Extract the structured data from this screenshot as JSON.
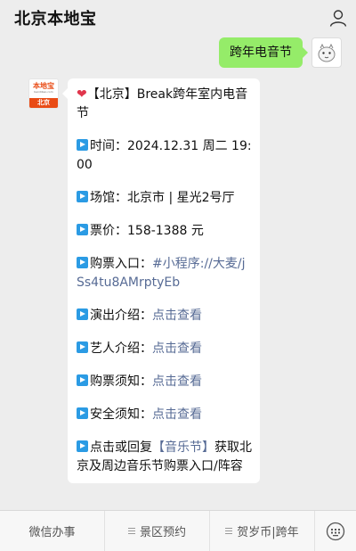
{
  "header": {
    "title": "北京本地宝",
    "profile_icon": "person-icon"
  },
  "outgoing": {
    "text": "跨年电音节"
  },
  "avatar_logo": {
    "main": "本地宝",
    "sub": "bendibao.com",
    "city": "北京"
  },
  "message": {
    "title": "【北京】Break跨年室内电音节",
    "time_label": "时间：",
    "time_value": "2024.12.31 周二 19:00",
    "venue_label": "场馆：",
    "venue_value": "北京市 | 星光2号厅",
    "price_label": "票价：",
    "price_value": "158-1388 元",
    "ticket_label": "购票入口：",
    "ticket_link": "#小程序://大麦/jSs4tu8AMrptyEb",
    "show_label": "演出介绍：",
    "show_link": "点击查看",
    "artist_label": "艺人介绍：",
    "artist_link": "点击查看",
    "notice_label": "购票须知：",
    "notice_link": "点击查看",
    "safety_label": "安全须知：",
    "safety_link": "点击查看",
    "reply_prefix": "点击或回复",
    "reply_keyword": "【音乐节】",
    "reply_suffix": "获取北京及周边音乐节购票入口/阵容"
  },
  "menu": {
    "items": [
      "微信办事",
      "景区预约",
      "贺岁币|跨年"
    ],
    "keyboard_icon": "keyboard-icon"
  },
  "colors": {
    "out_bubble": "#95ec69",
    "link": "#576b95",
    "play_icon": "#2b9be4",
    "heart": "#e0364c",
    "logo_accent": "#e94b15"
  }
}
